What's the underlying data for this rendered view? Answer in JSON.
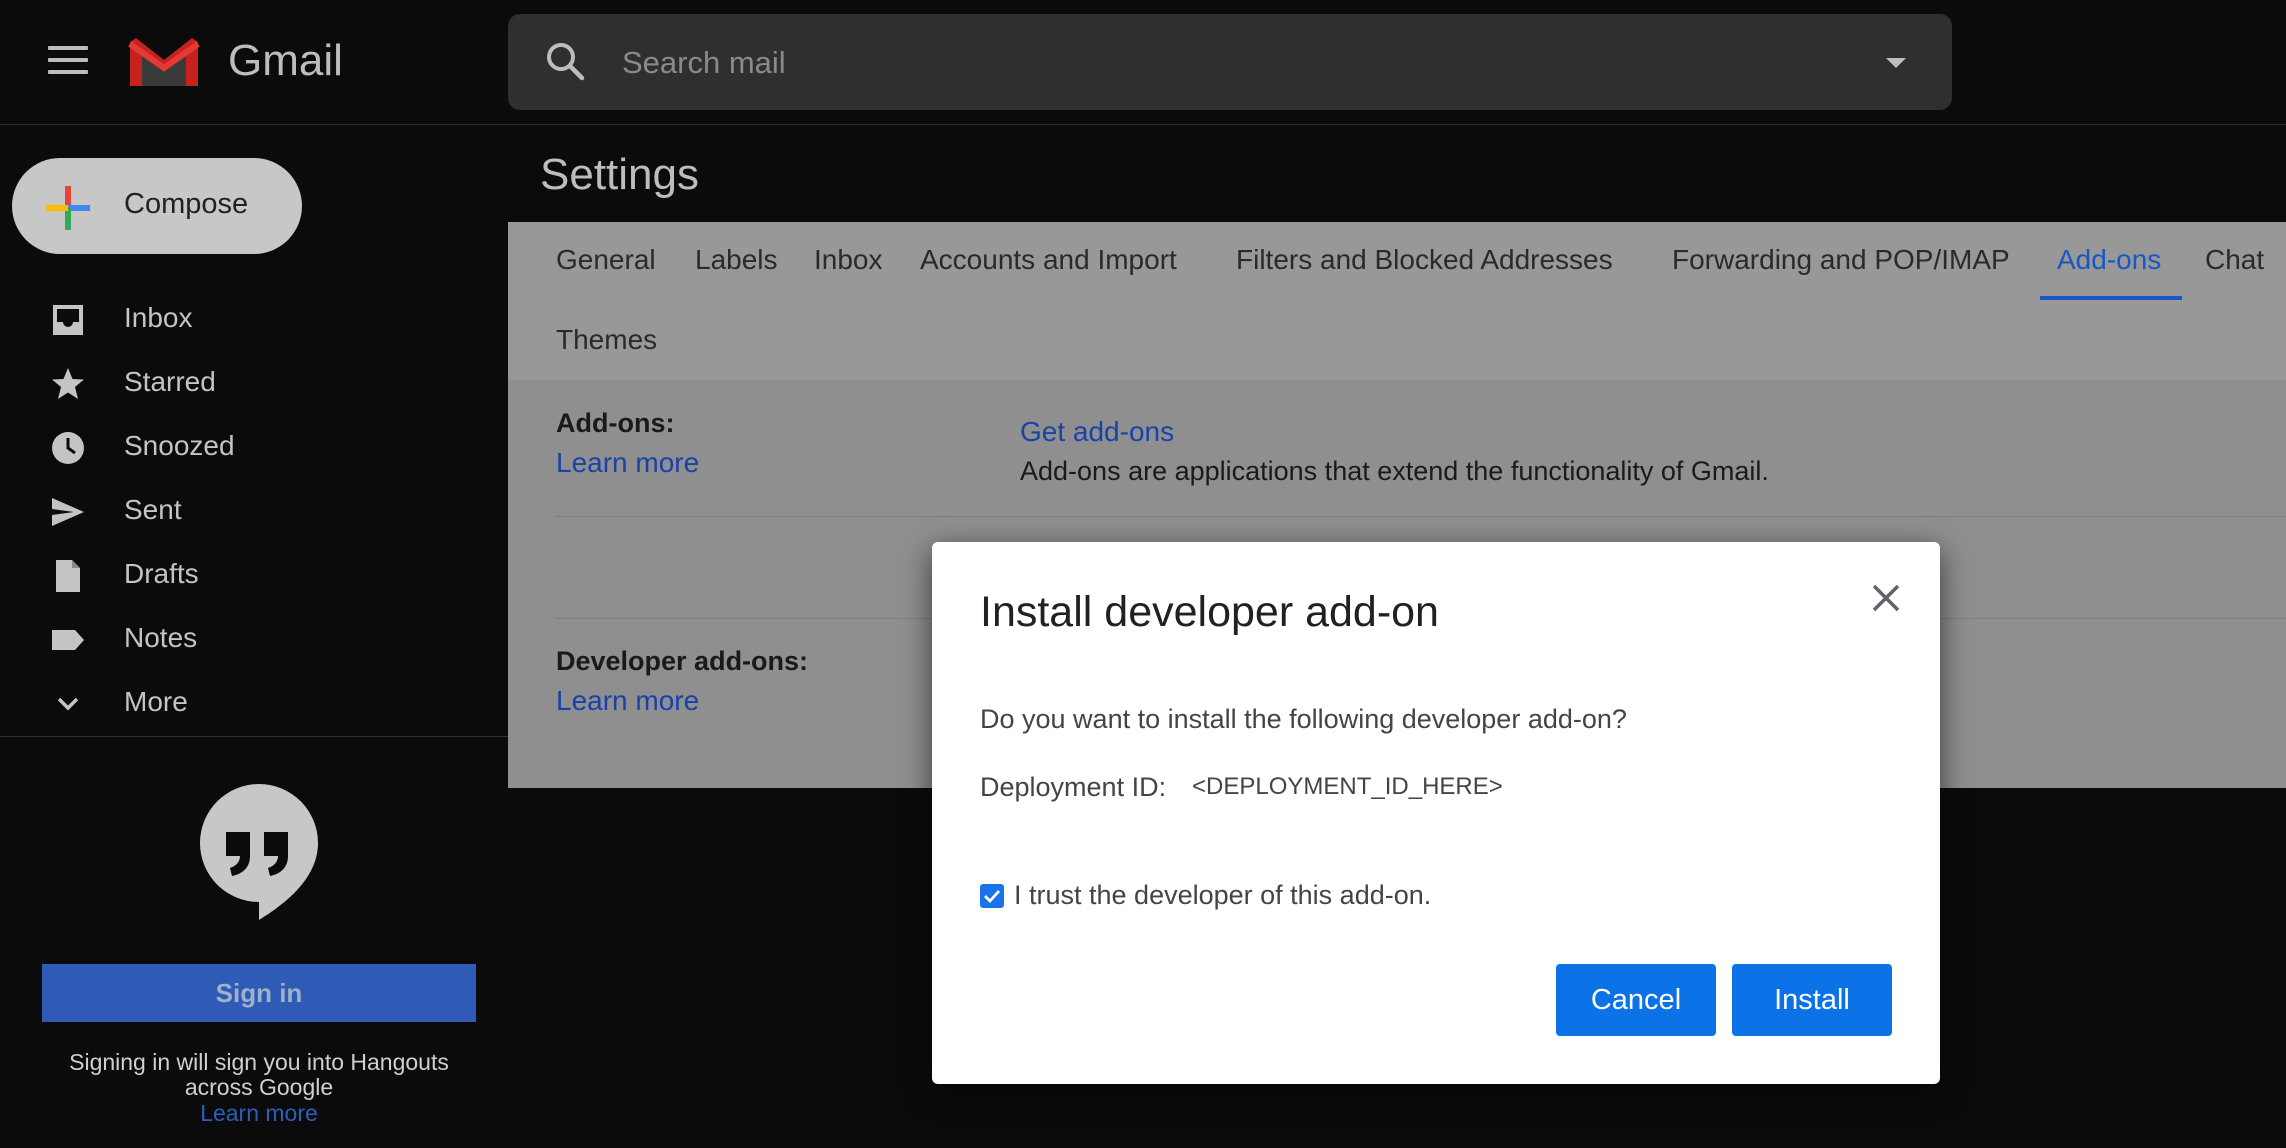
{
  "app": {
    "name": "Gmail"
  },
  "search": {
    "placeholder": "Search mail"
  },
  "compose": {
    "label": "Compose"
  },
  "sidebar": {
    "items": [
      {
        "label": "Inbox",
        "icon": "inbox-icon"
      },
      {
        "label": "Starred",
        "icon": "star-icon"
      },
      {
        "label": "Snoozed",
        "icon": "clock-icon"
      },
      {
        "label": "Sent",
        "icon": "send-icon"
      },
      {
        "label": "Drafts",
        "icon": "draft-icon"
      },
      {
        "label": "Notes",
        "icon": "label-icon"
      },
      {
        "label": "More",
        "icon": "chevron-down-icon"
      }
    ]
  },
  "hangouts": {
    "signin_label": "Sign in",
    "note": "Signing in will sign you into Hangouts across Google",
    "learn_more": "Learn more"
  },
  "settings": {
    "title": "Settings",
    "tabs": [
      {
        "label": "General"
      },
      {
        "label": "Labels"
      },
      {
        "label": "Inbox"
      },
      {
        "label": "Accounts and Import"
      },
      {
        "label": "Filters and Blocked Addresses"
      },
      {
        "label": "Forwarding and POP/IMAP"
      },
      {
        "label": "Add-ons",
        "active": true
      },
      {
        "label": "Chat"
      },
      {
        "label": "Themes"
      }
    ],
    "addons_row": {
      "label": "Add-ons:",
      "learn_more": "Learn more",
      "get_addons": "Get add-ons",
      "description": "Add-ons are applications that extend the functionality of Gmail."
    },
    "developer_row": {
      "label": "Developer add-ons:",
      "learn_more": "Learn more"
    }
  },
  "dialog": {
    "title": "Install developer add-on",
    "question": "Do you want to install the following developer add-on?",
    "deployment_label": "Deployment ID:",
    "deployment_value": "<DEPLOYMENT_ID_HERE>",
    "trust_label": "I trust the developer of this add-on.",
    "trust_checked": true,
    "cancel_label": "Cancel",
    "install_label": "Install"
  },
  "colors": {
    "accent": "#1a73e8",
    "active_tab": "#1a56c4",
    "background": "#0b0b0b"
  }
}
